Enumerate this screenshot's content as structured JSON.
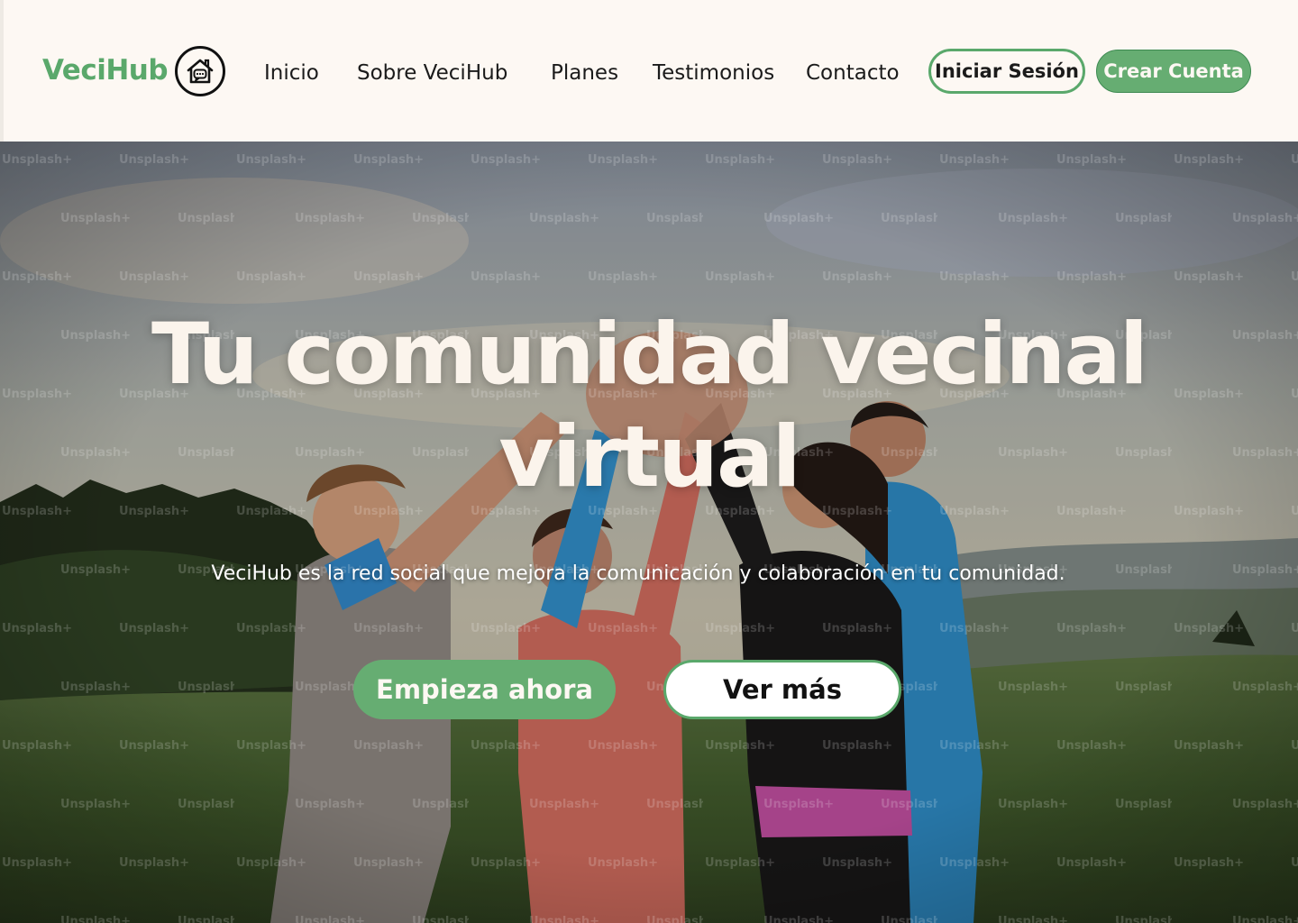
{
  "brand": {
    "name": "VeciHub",
    "icon": "house-chat-icon",
    "color": "#5aa86b"
  },
  "nav": {
    "items": [
      {
        "label": "Inicio"
      },
      {
        "label": "Sobre VeciHub"
      },
      {
        "label": "Planes"
      },
      {
        "label": "Testimonios"
      },
      {
        "label": "Contacto"
      }
    ]
  },
  "auth": {
    "login_label": "Iniciar Sesión",
    "signup_label": "Crear Cuenta"
  },
  "hero": {
    "title_line1": "Tu comunidad vecinal",
    "title_line2": "virtual",
    "subtitle": "VeciHub es la red social que mejora la comunicación y colaboración en tu comunidad.",
    "primary_cta": "Empieza ahora",
    "secondary_cta": "Ver más",
    "watermark_text": "Unsplash+"
  },
  "colors": {
    "accent_green": "#66ad72",
    "background": "#fdf8f3",
    "text_dark": "#1b1b1b"
  }
}
